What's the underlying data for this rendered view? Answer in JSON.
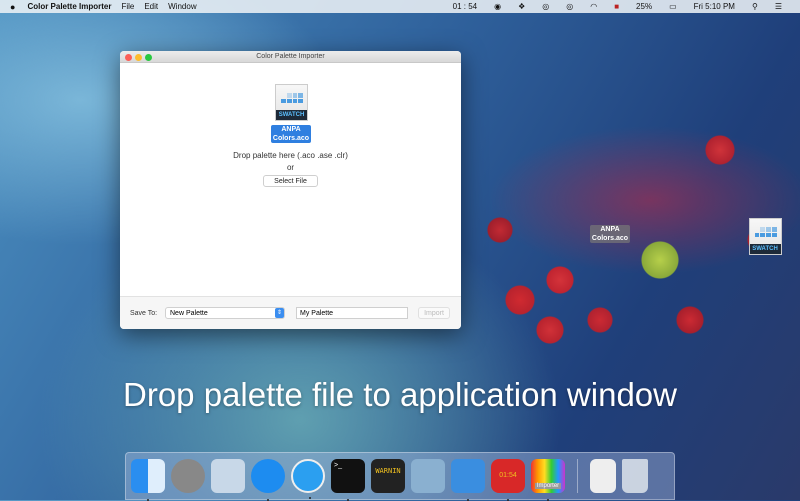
{
  "menubar": {
    "app_name": "Color Palette Importer",
    "menus": [
      "File",
      "Edit",
      "Window"
    ],
    "timer": "01 : 54",
    "battery": "25%",
    "clock": "Fri 5:10 PM"
  },
  "window": {
    "title": "Color Palette Importer",
    "file_icon_label": "SWATCH",
    "file_name_line1": "ANPA",
    "file_name_line2": "Colors.aco",
    "drop_text": "Drop palette here (.aco .ase .clr)",
    "or_text": "or",
    "select_file": "Select File",
    "save_to_label": "Save To:",
    "save_to_value": "New Palette",
    "palette_name": "My Palette",
    "import_label": "Import"
  },
  "desktop_file": {
    "icon_label": "SWATCH",
    "name_line1": "ANPA",
    "name_line2": "Colors.aco"
  },
  "caption": "Drop palette file to application window",
  "dock": {
    "clock_icon_text": "01:54",
    "console_text": "WARNIN",
    "importer_label": "Importer"
  }
}
